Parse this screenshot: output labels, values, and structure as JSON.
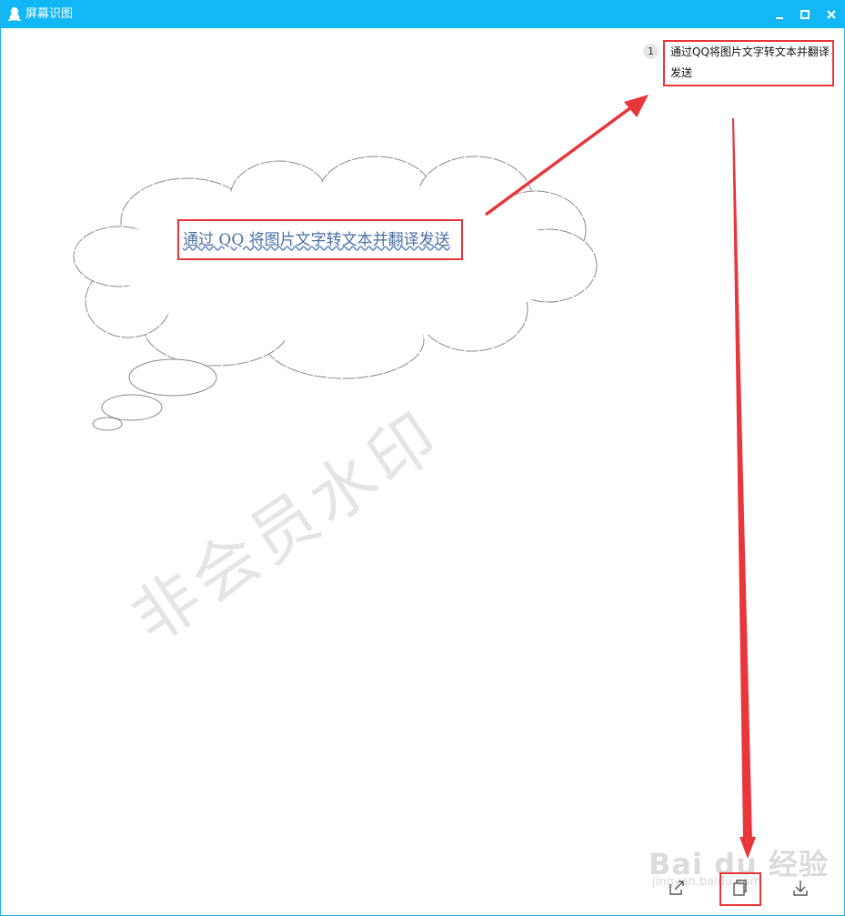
{
  "window": {
    "title": "屏幕识图",
    "titlebar_color": "#12b7f5",
    "icons": {
      "app": "qq-penguin-icon",
      "minimize": "minimize-icon",
      "maximize": "maximize-icon",
      "close": "close-icon"
    }
  },
  "result": {
    "index": "1",
    "text": "通过QQ将图片文字转文本并翻译发送"
  },
  "image": {
    "cloud_text": "通过 QQ 将图片文字转文本并翻译发送",
    "watermark": "非会员水印",
    "baidu_logo": "Bai du 经验",
    "baidu_url": "jingyan.baidu.com"
  },
  "toolbar": {
    "share_icon": "share-icon",
    "copy_icon": "copy-icon",
    "download_icon": "download-icon"
  },
  "colors": {
    "annotation_red": "#e8363b",
    "accent_blue": "#12b7f5"
  }
}
